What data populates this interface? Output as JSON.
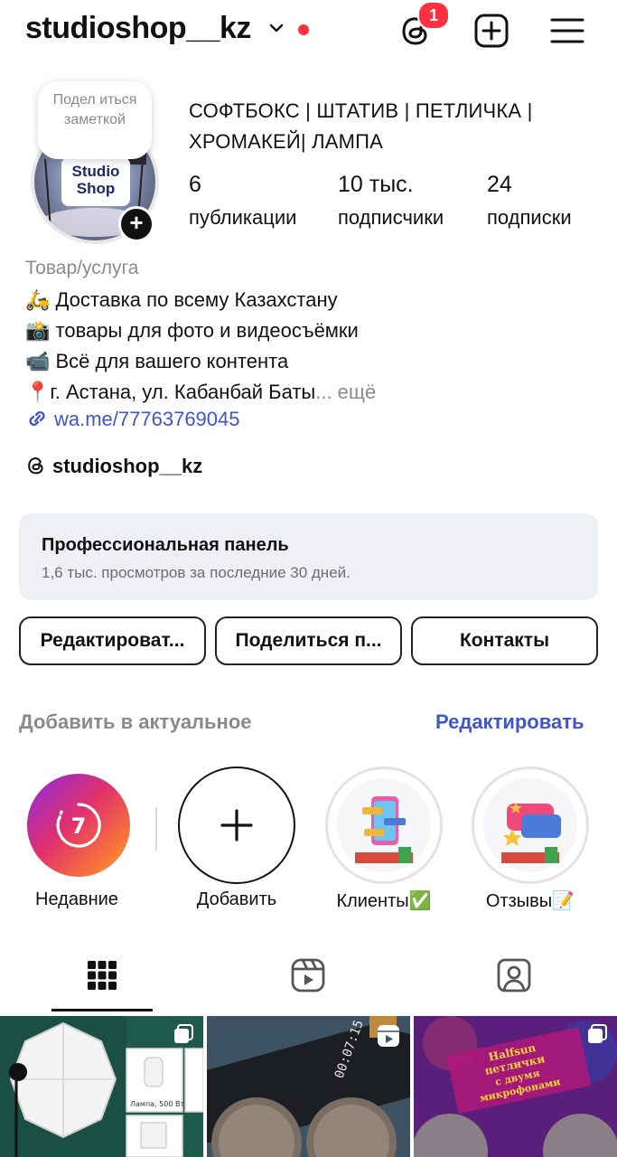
{
  "header": {
    "username": "studioshop__kz",
    "threads_badge": "1"
  },
  "profile": {
    "note_text": "Подел иться заметкой",
    "avatar_logo_text": "Studio Shop",
    "headline": "СОФТБОКС | ШТАТИВ | ПЕТЛИЧКА | ХРОМАКЕЙ| ЛАМПА",
    "stats": [
      {
        "value": "6",
        "label": "публикации"
      },
      {
        "value": "10 тыс.",
        "label": "подписчики"
      },
      {
        "value": "24",
        "label": "подписки"
      }
    ],
    "category": "Товар/услуга",
    "bio": [
      "🛵 Доставка по всему Казахстану",
      "📸 товары для фото и видеосъёмки",
      "📹 Всё для вашего контента",
      "📍г. Астана, ул. Кабанбай Баты"
    ],
    "bio_more": "... ещё",
    "link": "wa.me/77763769045",
    "threads_handle": "studioshop__kz"
  },
  "pro_panel": {
    "title": "Профессиональная панель",
    "subtitle": "1,6 тыс. просмотров за последние 30 дней."
  },
  "buttons": {
    "edit": "Редактироват...",
    "share": "Поделиться п...",
    "contacts": "Контакты"
  },
  "highlights": {
    "title": "Добавить в актуальное",
    "edit_label": "Редактировать",
    "items": [
      {
        "label": "Недавние",
        "count": "7"
      },
      {
        "label": "Добавить"
      },
      {
        "label": "Клиенты✅"
      },
      {
        "label": "Отзывы📝"
      }
    ]
  },
  "posts": {
    "p1_caption": "Лампа, 500 Вт",
    "p2_text": "00:07:15",
    "p3_lines": [
      "Halfsun",
      "петлички",
      "с двумя",
      "микрофонами"
    ]
  },
  "colors": {
    "accent_blue": "#3f56c9",
    "notification_red": "#ff3040",
    "panel_bg": "#eff0f3"
  }
}
